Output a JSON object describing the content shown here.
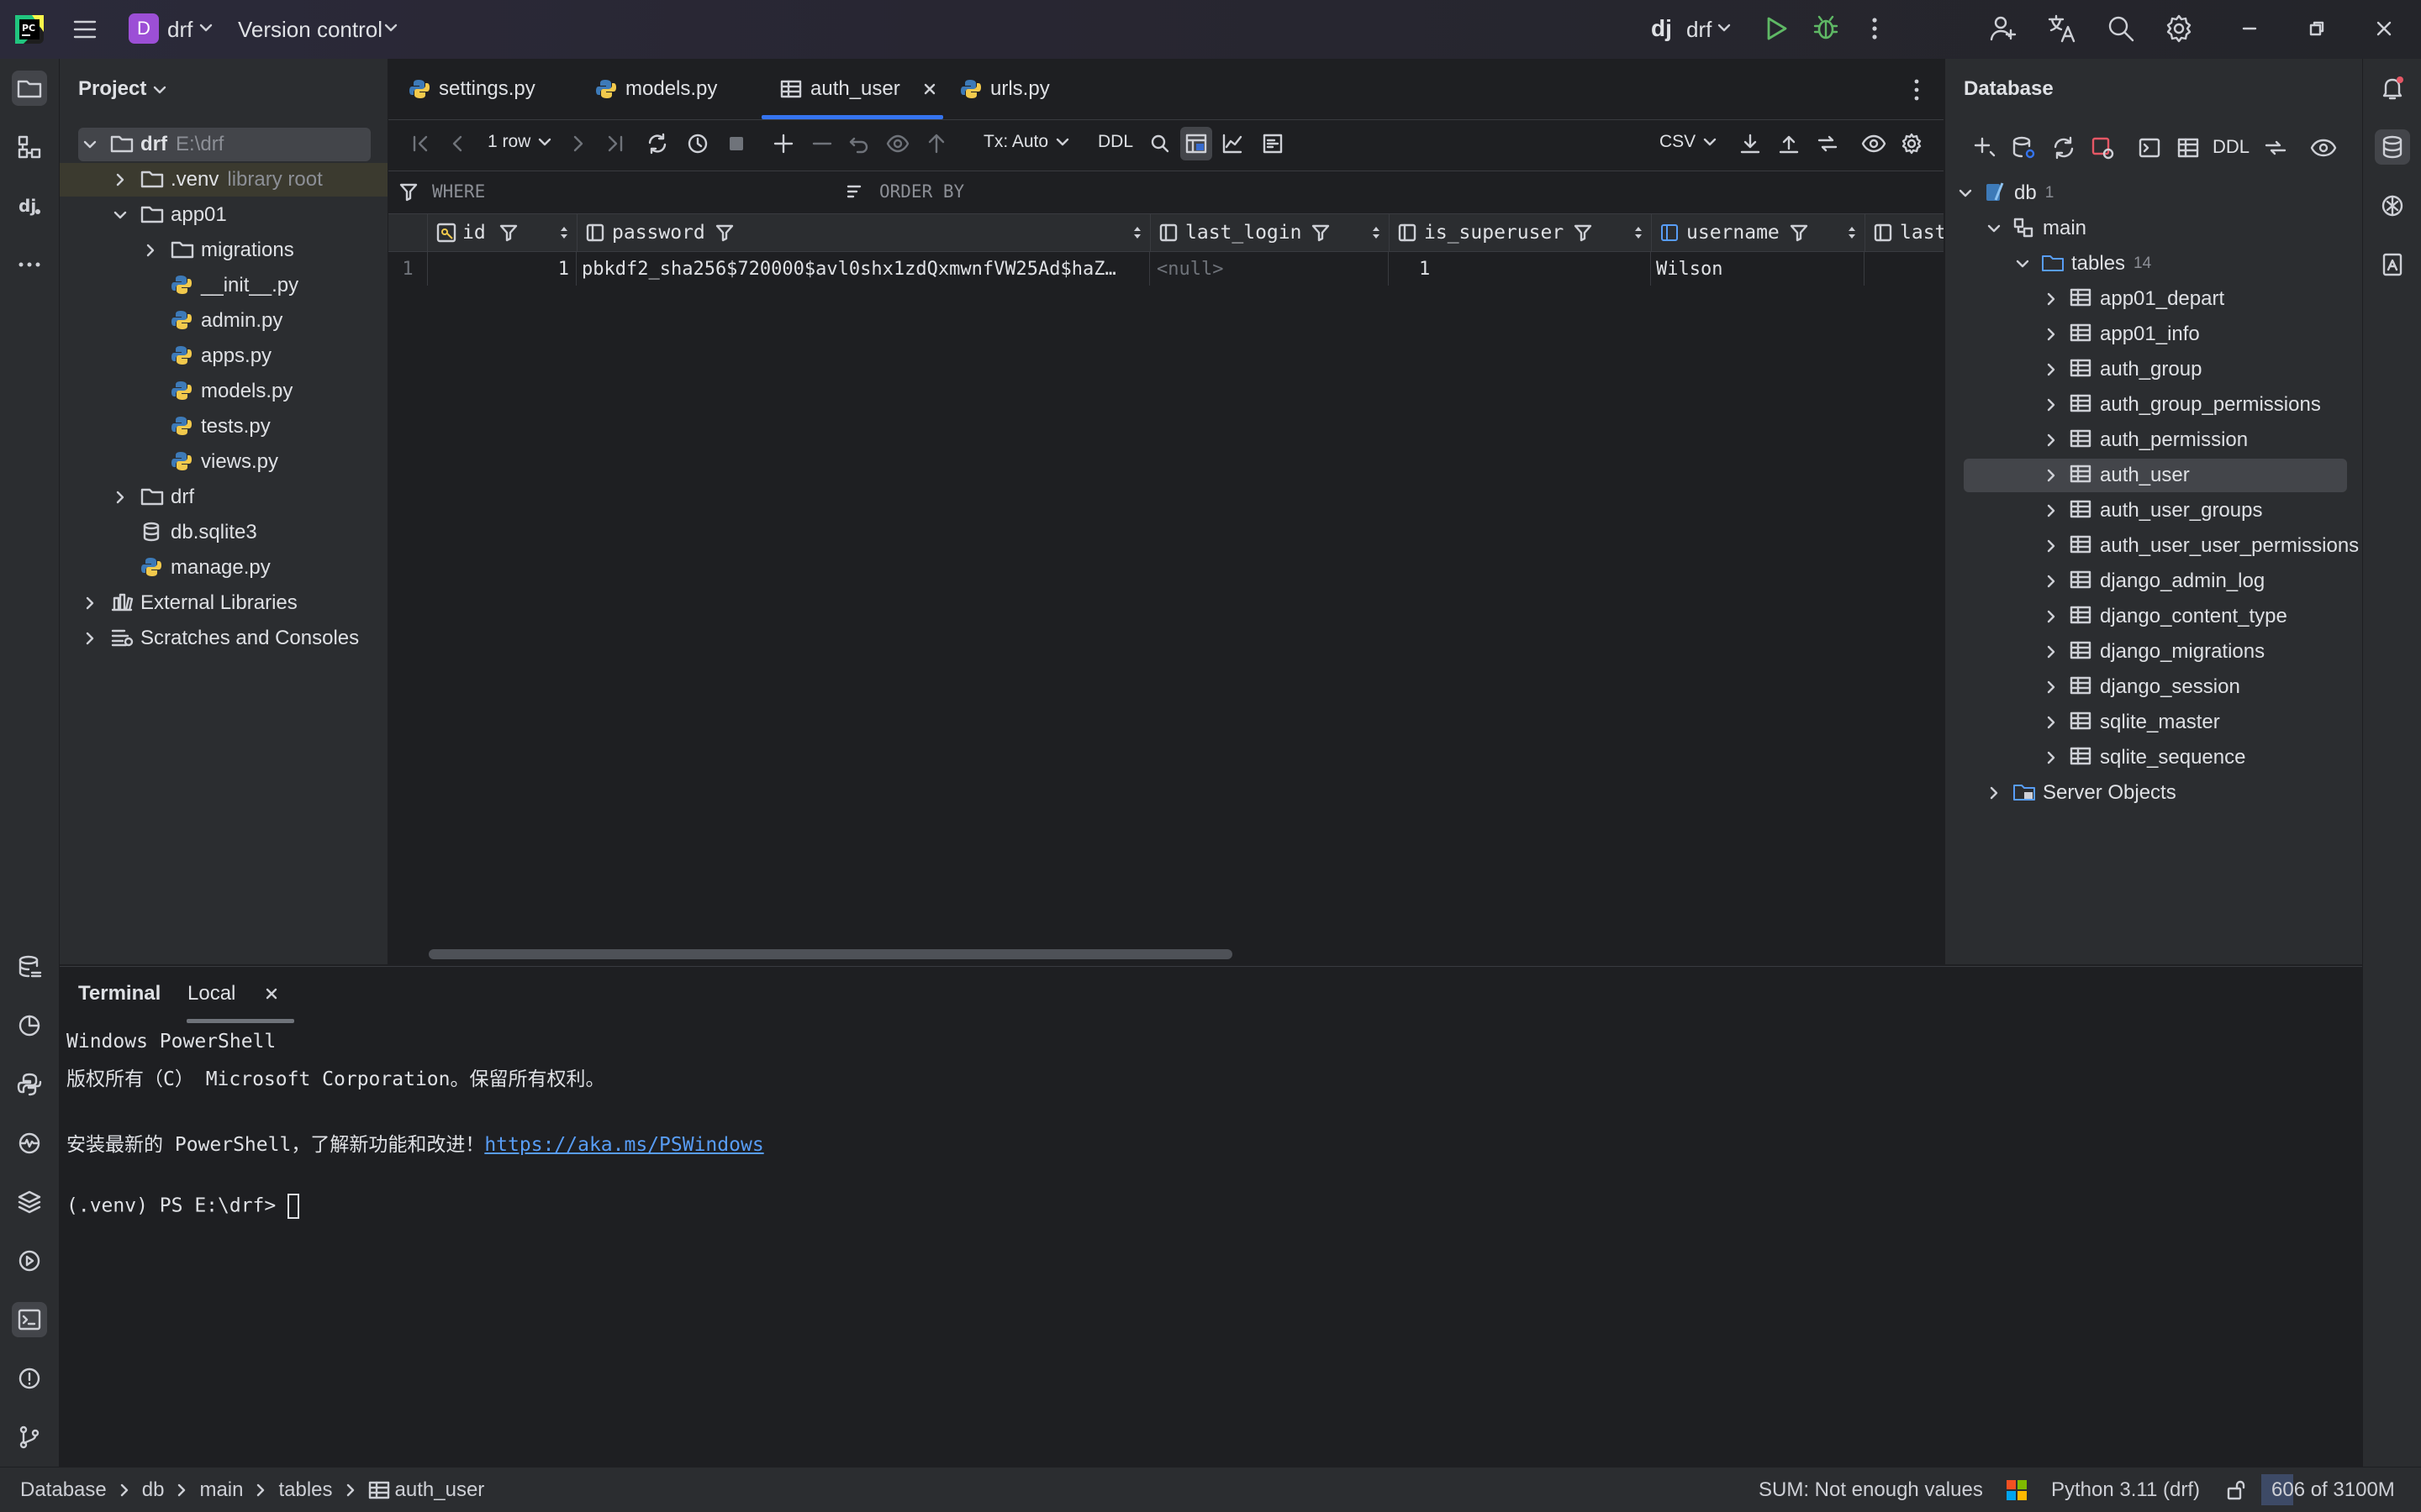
{
  "titlebar": {
    "project_badge": "D",
    "project_name": "drf",
    "vcs_label": "Version control",
    "run_config_icon": "dj",
    "run_config_name": "drf"
  },
  "project_panel": {
    "title": "Project",
    "tree": [
      {
        "label": "drf",
        "hint": "E:\\drf",
        "level": 0,
        "kind": "folder",
        "expanded": true,
        "selected": true
      },
      {
        "label": ".venv",
        "hint": "library root",
        "level": 1,
        "kind": "folder",
        "expanded": false
      },
      {
        "label": "app01",
        "level": 1,
        "kind": "folder",
        "expanded": true
      },
      {
        "label": "migrations",
        "level": 2,
        "kind": "folder",
        "expanded": false
      },
      {
        "label": "__init__.py",
        "level": 2,
        "kind": "python"
      },
      {
        "label": "admin.py",
        "level": 2,
        "kind": "python"
      },
      {
        "label": "apps.py",
        "level": 2,
        "kind": "python"
      },
      {
        "label": "models.py",
        "level": 2,
        "kind": "python"
      },
      {
        "label": "tests.py",
        "level": 2,
        "kind": "python"
      },
      {
        "label": "views.py",
        "level": 2,
        "kind": "python"
      },
      {
        "label": "drf",
        "level": 1,
        "kind": "folder",
        "expanded": false
      },
      {
        "label": "db.sqlite3",
        "level": 1,
        "kind": "database"
      },
      {
        "label": "manage.py",
        "level": 1,
        "kind": "python"
      },
      {
        "label": "External Libraries",
        "level": 0,
        "kind": "library",
        "expanded": false
      },
      {
        "label": "Scratches and Consoles",
        "level": 0,
        "kind": "scratch",
        "expanded": false
      }
    ]
  },
  "tabs": [
    {
      "label": "settings.py",
      "kind": "python"
    },
    {
      "label": "models.py",
      "kind": "python"
    },
    {
      "label": "auth_user",
      "kind": "table",
      "active": true
    },
    {
      "label": "urls.py",
      "kind": "python"
    }
  ],
  "data_toolbar": {
    "rows_label": "1 row",
    "tx_label": "Tx: Auto",
    "ddl_label": "DDL",
    "export_format": "CSV"
  },
  "filter": {
    "where_label": "WHERE",
    "order_label": "ORDER BY"
  },
  "grid": {
    "columns": [
      "id",
      "password",
      "last_login",
      "is_superuser",
      "username",
      "last"
    ],
    "rows": [
      {
        "num": "1",
        "id": "1",
        "password": "pbkdf2_sha256$720000$avl0shx1zdQxmwnfVW25Ad$haZ…",
        "last_login": "<null>",
        "is_superuser": "1",
        "username": "Wilson"
      }
    ]
  },
  "database_panel": {
    "title": "Database",
    "ddl_label": "DDL",
    "db_name": "db",
    "db_count": "1",
    "schema": "main",
    "tables_label": "tables",
    "tables_count": "14",
    "tables": [
      "app01_depart",
      "app01_info",
      "auth_group",
      "auth_group_permissions",
      "auth_permission",
      "auth_user",
      "auth_user_groups",
      "auth_user_user_permissions",
      "django_admin_log",
      "django_content_type",
      "django_migrations",
      "django_session",
      "sqlite_master",
      "sqlite_sequence"
    ],
    "selected_table": "auth_user",
    "server_objects": "Server Objects"
  },
  "terminal": {
    "title": "Terminal",
    "tab": "Local",
    "line1": "Windows PowerShell",
    "line2": "版权所有（C） Microsoft Corporation。保留所有权利。",
    "line3_prefix": "安装最新的 PowerShell，了解新功能和改进！",
    "line3_link": "https://aka.ms/PSWindows",
    "prompt": "(.venv) PS E:\\drf> "
  },
  "statusbar": {
    "breadcrumb": [
      "Database",
      "db",
      "main",
      "tables",
      "auth_user"
    ],
    "sum": "SUM: Not enough values",
    "interpreter": "Python 3.11 (drf)",
    "memory": "606 of 3100M"
  },
  "colors": {
    "accent": "#3574f0",
    "python_blue": "#3d7ab8",
    "python_yellow": "#f2c94c",
    "run_green": "#5fb865",
    "badge_purple": "#9c4fd6",
    "link": "#589df6"
  }
}
